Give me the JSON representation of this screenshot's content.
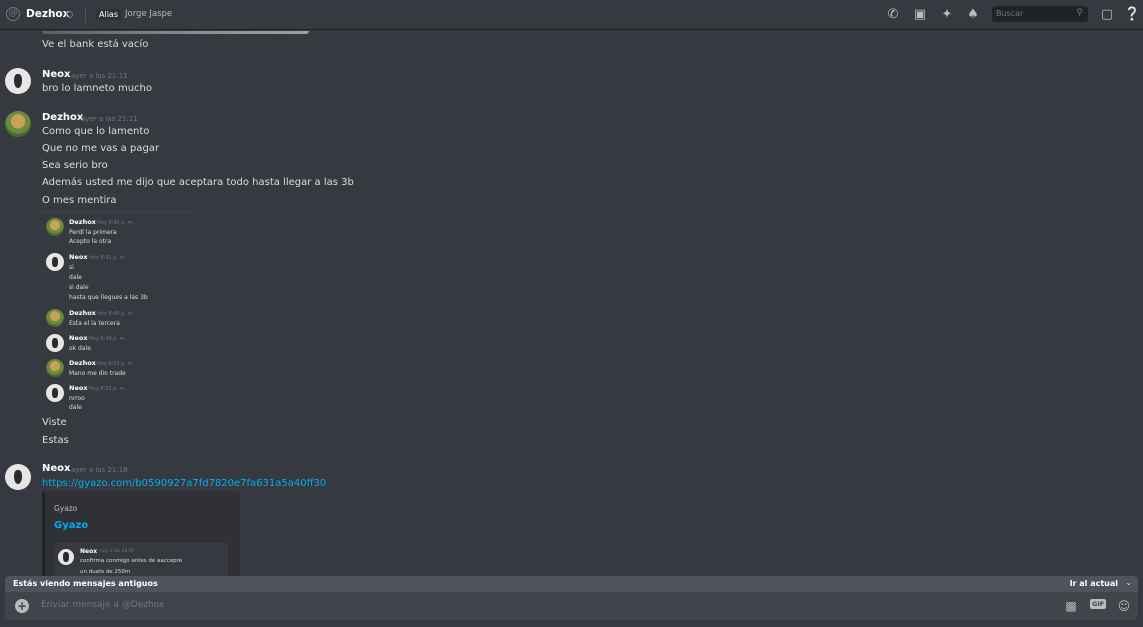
{
  "header": {
    "at_symbol": "@",
    "name": "Dezhox",
    "alias_label": "Alias",
    "alias_value": "Jorge Jaspe",
    "search_placeholder": "Buscar",
    "icons": [
      "phone-icon",
      "video-icon",
      "pin-icon",
      "add-friend-icon",
      "search-icon",
      "inbox-icon",
      "help-icon"
    ]
  },
  "messages": [
    {
      "text": "Ve el bank está vacío"
    },
    {
      "user": "Neox",
      "time": "ayer a las 21:11",
      "lines": [
        "bro lo lamneto mucho"
      ]
    },
    {
      "user": "Dezhox",
      "time": "ayer a las 21:11",
      "lines": [
        "Como que lo lamento",
        "Que no me vas a pagar",
        "Sea serio bro",
        "Además usted me dijo que aceptara todo hasta llegar a las 3b",
        "O mes mentira"
      ]
    },
    {
      "lines_after_quote": [
        "Viste",
        "Estas"
      ]
    },
    {
      "user": "Neox",
      "time": "ayer a las 21:18",
      "link": "https://gyazo.com/b0590927a7fd7820e7fa631a5a40ff30",
      "embed": {
        "provider": "Gyazo",
        "title": "Gyazo",
        "inner": {
          "user": "Neox",
          "time": "hoy a las 20:05",
          "lines": [
            "confirma conmigo antes de aaccepre",
            "un duelo de 250m"
          ]
        }
      }
    }
  ],
  "quote": [
    {
      "user": "Dezhox",
      "time": "Hoy 8:40 p. m.",
      "lines": [
        "Perdí la primera",
        "Acepto la otra"
      ]
    },
    {
      "user": "Neox",
      "time": "Hoy 8:41 p. m.",
      "lines": [
        "si",
        "dale",
        "si dale",
        "hasta que llegues a las 3b"
      ]
    },
    {
      "user": "Dezhox",
      "time": "Hoy 8:48 p. m.",
      "lines": [
        "Esta el la tercera"
      ]
    },
    {
      "user": "Neox",
      "time": "Hoy 8:49 p. m.",
      "lines": [
        "ok dale"
      ]
    },
    {
      "user": "Dezhox",
      "time": "Hoy 8:52 p. m.",
      "lines": [
        "Mano me dio trade"
      ]
    },
    {
      "user": "Neox",
      "time": "Hoy 8:52 p. m.",
      "lines": [
        "nrroo",
        "dale"
      ]
    }
  ],
  "old_messages_bar": {
    "left": "Estás viendo mensajes antiguos",
    "right": "Ir al actual"
  },
  "composer": {
    "placeholder": "Enviar mensaje a @Dezhox",
    "gif_label": "GIF"
  }
}
